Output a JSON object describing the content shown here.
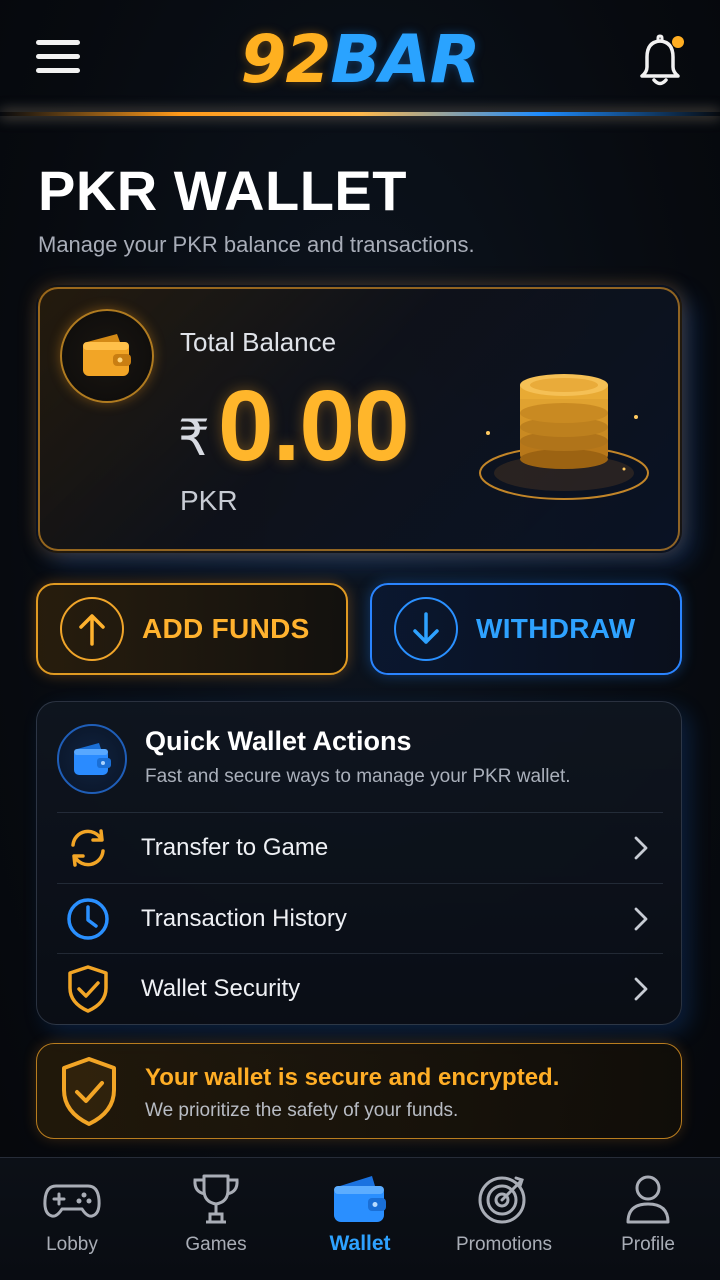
{
  "header": {
    "logo_part1": "92",
    "logo_part2": "BAR",
    "menu_icon": "hamburger-menu-icon",
    "notification_icon": "bell-icon",
    "notification_dot": true
  },
  "page": {
    "title": "PKR WALLET",
    "subtitle": "Manage your PKR balance and transactions."
  },
  "balance": {
    "label": "Total Balance",
    "symbol": "₹",
    "amount": "0.00",
    "currency": "PKR",
    "icon": "wallet-icon"
  },
  "actions": {
    "add_funds": "ADD FUNDS",
    "withdraw": "WITHDRAW"
  },
  "quick_actions": {
    "title": "Quick Wallet Actions",
    "subtitle": "Fast and secure ways to manage your PKR wallet.",
    "items": [
      {
        "label": "Transfer to Game",
        "icon": "transfer-icon"
      },
      {
        "label": "Transaction History",
        "icon": "clock-icon"
      },
      {
        "label": "Wallet Security",
        "icon": "shield-check-icon"
      }
    ]
  },
  "security_banner": {
    "title": "Your wallet is secure and encrypted.",
    "subtitle": "We prioritize the safety of your funds."
  },
  "nav": {
    "items": [
      {
        "label": "Lobby",
        "icon": "gamepad-icon",
        "active": false
      },
      {
        "label": "Games",
        "icon": "trophy-icon",
        "active": false
      },
      {
        "label": "Wallet",
        "icon": "wallet-icon",
        "active": true
      },
      {
        "label": "Promotions",
        "icon": "target-icon",
        "active": false
      },
      {
        "label": "Profile",
        "icon": "user-icon",
        "active": false
      }
    ]
  },
  "colors": {
    "accent_orange": "#ffb62b",
    "accent_blue": "#2ea2ff",
    "background": "#070a0f"
  }
}
